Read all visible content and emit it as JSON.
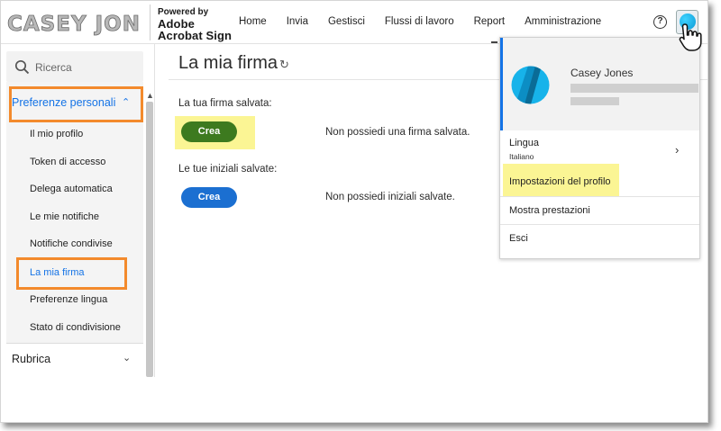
{
  "header": {
    "brand_logo_text": "CASEY JONES",
    "powered_by": "Powered by",
    "product_line1": "Adobe",
    "product_line2": "Acrobat Sign",
    "nav": [
      "Home",
      "Invia",
      "Gestisci",
      "Flussi di lavoro",
      "Report",
      "Amministrazione"
    ],
    "help_icon": "question-circle-icon",
    "avatar_icon": "user-avatar-icon"
  },
  "sidebar": {
    "search_placeholder": "Ricerca",
    "section_title": "Preferenze personali",
    "items": [
      "Il mio profilo",
      "Token di accesso",
      "Delega automatica",
      "Le mie notifiche",
      "Notifiche condivise",
      "La mia firma",
      "Preferenze lingua",
      "Stato di condivisione"
    ],
    "active_item": "La mia firma",
    "section2_title": "Rubrica"
  },
  "main": {
    "title": "La mia firma",
    "signature_label": "La tua firma salvata:",
    "signature_button": "Crea",
    "signature_message": "Non possiedi una firma salvata.",
    "initials_label": "Le tue iniziali salvate:",
    "initials_button": "Crea",
    "initials_message": "Non possiedi iniziali salvate."
  },
  "dropdown": {
    "user_name": "Casey Jones",
    "language_label": "Lingua",
    "language_value": "Italiano",
    "profile_settings": "Impostazioni del profilo",
    "show_performance": "Mostra prestazioni",
    "logout": "Esci"
  },
  "colors": {
    "accent_blue": "#1473e6",
    "highlight_orange": "#f38a2c",
    "highlight_yellow": "#fbf594",
    "crea_green": "#3d7a1f",
    "crea_blue": "#1b6fd1"
  }
}
